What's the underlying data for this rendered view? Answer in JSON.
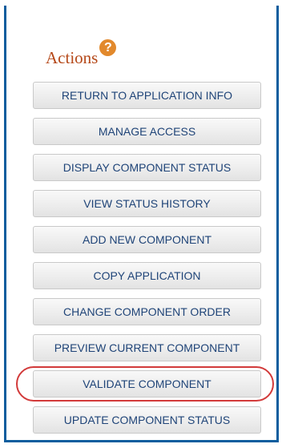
{
  "panel": {
    "title": "Actions",
    "help_icon_glyph": "?"
  },
  "actions": [
    {
      "label": "RETURN TO APPLICATION INFO"
    },
    {
      "label": "MANAGE ACCESS"
    },
    {
      "label": "DISPLAY COMPONENT STATUS"
    },
    {
      "label": "VIEW STATUS HISTORY"
    },
    {
      "label": "ADD NEW COMPONENT"
    },
    {
      "label": "COPY APPLICATION"
    },
    {
      "label": "CHANGE COMPONENT ORDER"
    },
    {
      "label": "PREVIEW CURRENT COMPONENT"
    },
    {
      "label": "VALIDATE COMPONENT"
    },
    {
      "label": "UPDATE COMPONENT STATUS"
    }
  ],
  "colors": {
    "panel_border": "#0b5d9e",
    "title": "#b54818",
    "help_icon": "#e2892c",
    "button_text": "#1f4478",
    "highlight": "#d23a3a"
  }
}
